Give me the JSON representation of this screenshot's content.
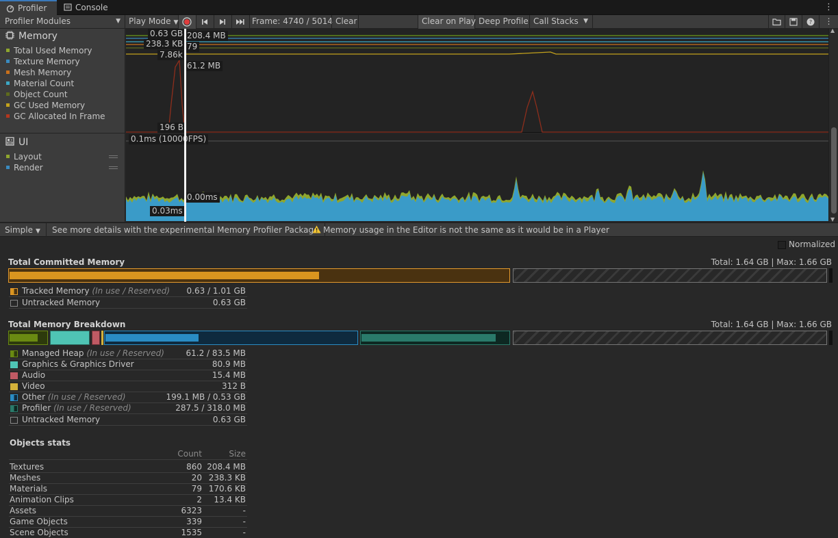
{
  "tabs": [
    {
      "label": "Profiler",
      "icon": "profiler-icon",
      "active": true
    },
    {
      "label": "Console",
      "icon": "console-icon",
      "active": false
    }
  ],
  "toolbar": {
    "modules_label": "Profiler Modules",
    "target_label": "Play Mode",
    "frame_label": "Frame: 4740 / 5014",
    "clear_label": "Clear",
    "clear_on_play_label": "Clear on Play",
    "deep_profile_label": "Deep Profile",
    "call_stacks_label": "Call Stacks"
  },
  "memory_module": {
    "title": "Memory",
    "legend": [
      {
        "label": "Total Used Memory",
        "color": "#8fa62e"
      },
      {
        "label": "Texture Memory",
        "color": "#3a8bc0"
      },
      {
        "label": "Mesh Memory",
        "color": "#c8701c"
      },
      {
        "label": "Material Count",
        "color": "#3ca7c4"
      },
      {
        "label": "Object Count",
        "color": "#5e6b1d"
      },
      {
        "label": "GC Used Memory",
        "color": "#c3a21c"
      },
      {
        "label": "GC Allocated In Frame",
        "color": "#b4361e"
      }
    ],
    "tooltips": {
      "total": "0.63 GB",
      "texture": "208.4 MB",
      "mesh": "238.3 KB",
      "material": "79",
      "objects": "7.86k",
      "gc_used": "61.2 MB",
      "gc_alloc": "196 B"
    }
  },
  "ui_module": {
    "title": "UI",
    "legend": [
      {
        "label": "Layout",
        "color": "#8fa62e"
      },
      {
        "label": "Render",
        "color": "#3a8bc0"
      }
    ],
    "scale_label": "0.1ms (10000FPS)",
    "tip_layout": "0.00ms",
    "tip_render": "0.03ms"
  },
  "detail_bar": {
    "mode": "Simple",
    "link": "See more details with the experimental Memory Profiler Package.",
    "warning": "Memory usage in the Editor is not the same as it would be in a Player"
  },
  "normalized_label": "Normalized",
  "committed": {
    "title": "Total Committed Memory",
    "totals": "Total: 1.64 GB | Max: 1.66 GB",
    "tracked_fill": 0.62,
    "rows": [
      {
        "name": "Tracked Memory",
        "note": "(In use / Reserved)",
        "value": "0.63 / 1.01 GB"
      },
      {
        "name": "Untracked Memory",
        "note": "",
        "value": "0.63 GB"
      }
    ]
  },
  "breakdown": {
    "title": "Total Memory Breakdown",
    "totals": "Total: 1.64 GB | Max: 1.66 GB",
    "rows": [
      {
        "name": "Managed Heap",
        "note": "(In use / Reserved)",
        "value": "61.2 / 83.5 MB",
        "color": "#6a8a12"
      },
      {
        "name": "Graphics & Graphics Driver",
        "note": "",
        "value": "80.9 MB",
        "color": "#4fc4b4"
      },
      {
        "name": "Audio",
        "note": "",
        "value": "15.4 MB",
        "color": "#c05a64"
      },
      {
        "name": "Video",
        "note": "",
        "value": "312 B",
        "color": "#d4b23a"
      },
      {
        "name": "Other",
        "note": "(In use / Reserved)",
        "value": "199.1 MB / 0.53 GB",
        "color": "#2a8cc4"
      },
      {
        "name": "Profiler",
        "note": "(In use / Reserved)",
        "value": "287.5 / 318.0 MB",
        "color": "#2a7a6a"
      },
      {
        "name": "Untracked Memory",
        "note": "",
        "value": "0.63 GB",
        "color": "#555555"
      }
    ]
  },
  "objects_stats": {
    "title": "Objects stats",
    "col_count": "Count",
    "col_size": "Size",
    "rows": [
      {
        "name": "Textures",
        "count": "860",
        "size": "208.4 MB"
      },
      {
        "name": "Meshes",
        "count": "20",
        "size": "238.3 KB"
      },
      {
        "name": "Materials",
        "count": "79",
        "size": "170.6 KB"
      },
      {
        "name": "Animation Clips",
        "count": "2",
        "size": "13.4 KB"
      },
      {
        "name": "Assets",
        "count": "6323",
        "size": "-"
      },
      {
        "name": "Game Objects",
        "count": "339",
        "size": "-"
      },
      {
        "name": "Scene Objects",
        "count": "1535",
        "size": "-"
      }
    ]
  }
}
